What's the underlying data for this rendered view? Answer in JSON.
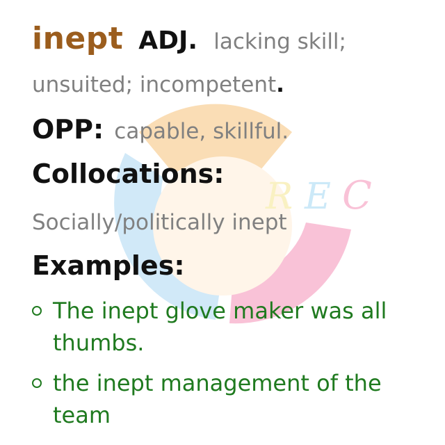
{
  "entry": {
    "headword": "inept",
    "pos": "ADJ.",
    "definition_line1": "lacking skill;",
    "definition_line2": "unsuited; incompetent",
    "definition_end": ".",
    "opp_label": "OPP:",
    "opp_values": "capable, skillful",
    "opp_end": ".",
    "collocations_label": "Collocations:",
    "collocation": "Socially/politically inept",
    "examples_label": "Examples:",
    "examples": [
      "The inept glove maker was all thumbs.",
      "the inept management of the team"
    ]
  },
  "watermark": {
    "letters": [
      "R",
      "E",
      "C"
    ],
    "colors": [
      "#f5b55c",
      "#9ad0f0",
      "#f27aa8",
      "#f3e27a"
    ]
  }
}
